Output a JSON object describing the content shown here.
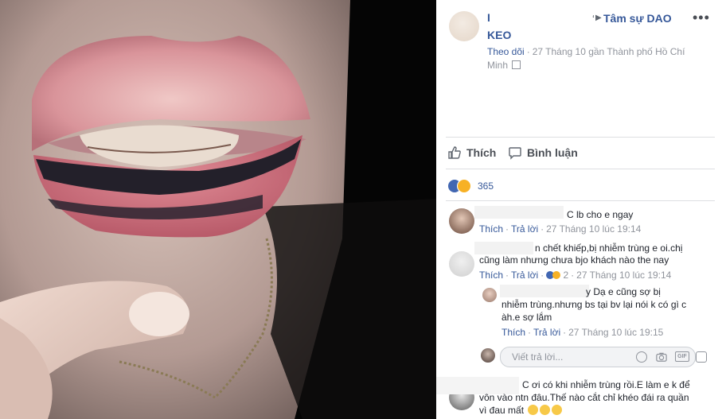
{
  "post": {
    "author_line1": "I",
    "author_line2": "KEO",
    "group": "Tâm sự DAO",
    "follow": "Theo dõi",
    "date": "27 Tháng 10 gần Thành phố Hồ Chí Minh",
    "more": "•••"
  },
  "actions": {
    "like": "Thích",
    "comment": "Bình luận"
  },
  "reactions": {
    "count": "365"
  },
  "comments": [
    {
      "text": "C lb cho e ngay",
      "like": "Thích",
      "reply": "Trả lời",
      "time": "27 Tháng 10 lúc 19:14"
    },
    {
      "text_line1": "n chết khiếp,bị nhiễm trùng e oi.chị",
      "text_line2": "cũng làm nhưng chưa bjo khách nào the nay",
      "like": "Thích",
      "reply": "Trả lời",
      "reaction_count": "2",
      "time": "27 Tháng 10 lúc 19:14"
    },
    {
      "text_line1": "y Dạ e cũng sợ bị",
      "text_line2": "nhiễm trùng.nhưng bs tại bv lại nói k có gì c",
      "text_line3": "àh.e sợ lắm",
      "like": "Thích",
      "reply": "Trả lời",
      "time": "27 Tháng 10 lúc 19:15"
    },
    {
      "text_line1": "C ơi có khi nhiễm trùng rồi.E làm e k để",
      "text_line2": "vôn vào ntn đâu.Thế nào cắt chỉ khéo đái ra quần",
      "text_line3": "vì đau mất"
    }
  ],
  "reply_box": {
    "placeholder": "Viết trả lời..."
  },
  "icons": [
    "more-icon",
    "like-icon",
    "comment-icon",
    "camera-icon",
    "gif-icon",
    "sticker-icon",
    "emoji-icon"
  ],
  "colors": {
    "link": "#365899",
    "meta": "#90949c",
    "text": "#1d2129",
    "like_blue": "#4267b2"
  }
}
